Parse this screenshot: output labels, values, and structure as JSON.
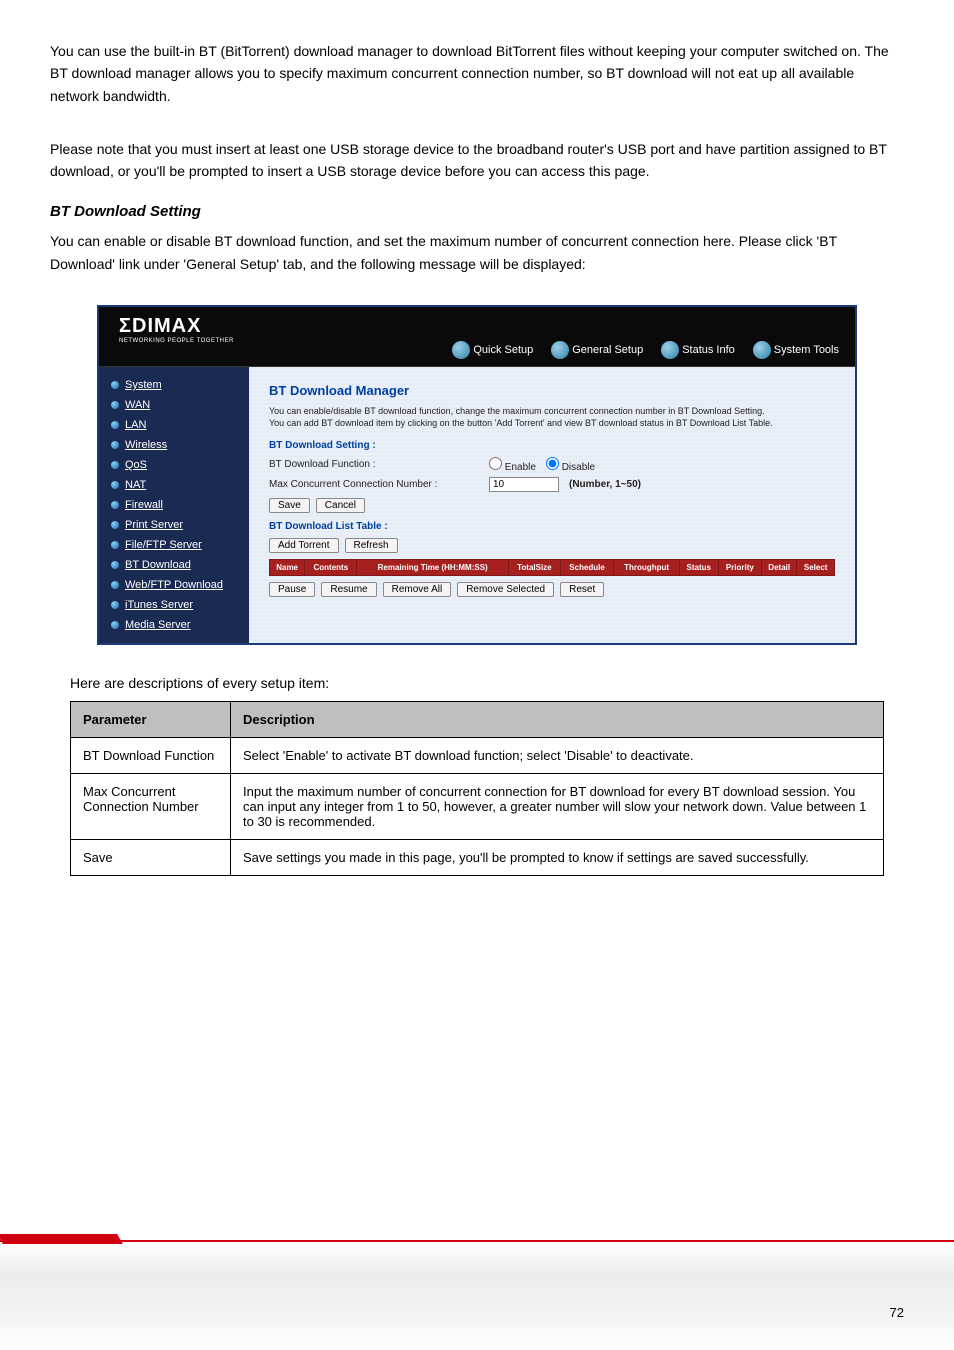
{
  "intro": {
    "p1": "You can use the built-in BT (BitTorrent) download manager to download BitTorrent files without keeping your computer switched on. The BT download manager allows you to specify maximum concurrent connection number, so BT download will not eat up all available network bandwidth.",
    "p2": "Please note that you must insert at least one USB storage device to the broadband router's USB port and have partition assigned to BT download, or you'll be prompted to insert a USB storage device before you can access this page.",
    "bt_setting_head": "BT Download Setting",
    "p3": "You can enable or disable BT download function, and set the maximum number of concurrent connection here. Please click 'BT Download' link under 'General Setup' tab, and the following message will be displayed:"
  },
  "router": {
    "logo_main": "ΣDIMAX",
    "logo_sub": "NETWORKING PEOPLE TOGETHER",
    "tabs": [
      "Quick Setup",
      "General Setup",
      "Status Info",
      "System Tools"
    ],
    "sidebar": [
      {
        "label": "System"
      },
      {
        "label": "WAN"
      },
      {
        "label": "LAN"
      },
      {
        "label": "Wireless"
      },
      {
        "label": "QoS"
      },
      {
        "label": "NAT"
      },
      {
        "label": "Firewall"
      },
      {
        "label": "Print Server"
      },
      {
        "label": "File/FTP Server"
      },
      {
        "label": "BT Download",
        "active": true
      },
      {
        "label": "Web/FTP Download"
      },
      {
        "label": "iTunes Server"
      },
      {
        "label": "Media Server"
      }
    ],
    "panel": {
      "title": "BT Download Manager",
      "desc1": "You can enable/disable BT download function, change the maximum concurrent connection number in BT Download Setting.",
      "desc2": "You can add BT download item by clicking on the button 'Add Torrent' and view BT download status in BT Download List Table.",
      "setting_label": "BT Download Setting :",
      "func_label": "BT Download Function :",
      "enable": "Enable",
      "disable": "Disable",
      "max_conn_label": "Max Concurrent Connection Number :",
      "max_conn_value": "10",
      "max_conn_hint": "(Number, 1~50)",
      "save": "Save",
      "cancel": "Cancel",
      "list_label": "BT Download List Table :",
      "add_torrent": "Add Torrent",
      "refresh": "Refresh",
      "headers": [
        "Name",
        "Contents",
        "Remaining Time (HH:MM:SS)",
        "TotalSize",
        "Schedule",
        "Throughput",
        "Status",
        "Priority",
        "Detail",
        "Select"
      ],
      "pause": "Pause",
      "resume": "Resume",
      "remove_all": "Remove All",
      "remove_selected": "Remove Selected",
      "reset": "Reset"
    }
  },
  "param_intro": "Here are descriptions of every setup item:",
  "param_table": {
    "h1": "Parameter",
    "h2": "Description",
    "rows": [
      {
        "name": "BT Download Function",
        "desc": "Select 'Enable' to activate BT download function; select 'Disable' to deactivate."
      },
      {
        "name": "Max Concurrent Connection Number",
        "desc": "Input the maximum number of concurrent connection for BT download for every BT download session. You can input any integer from 1 to 50, however, a greater number will slow your network down. Value between 1 to 30 is recommended."
      },
      {
        "name": "Save",
        "desc": "Save settings you made in this page, you'll be prompted to know if settings are saved successfully."
      }
    ]
  },
  "page_number": "72"
}
